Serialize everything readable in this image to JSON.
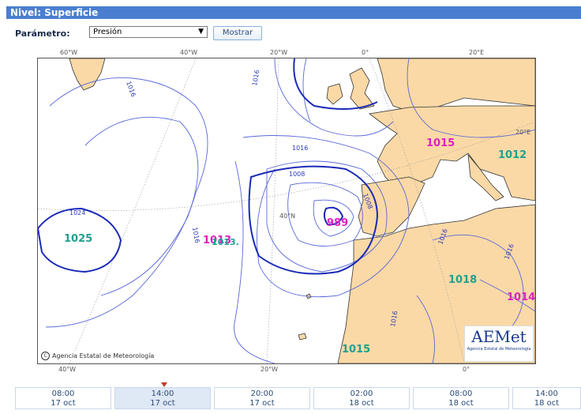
{
  "header": {
    "title": "Nivel: Superficie"
  },
  "controls": {
    "param_label": "Parámetro:",
    "param_value": "Presión",
    "show_label": "Mostrar"
  },
  "map": {
    "top_lon_labels": [
      "60°W",
      "40°W",
      "20°W",
      "0°",
      "20°E"
    ],
    "bottom_lon_labels": [
      "40°W",
      "20°W",
      "0°"
    ],
    "right_lat_label": "20°E",
    "inner_lat_label": "40°N",
    "attribution": "Agencia Estatal de Meteorología",
    "logo_text": "AEMet",
    "logo_sub": "Agencia Estatal de Meteorología",
    "isobar_labels": [
      "1016",
      "1016",
      "1016",
      "1008",
      "1008",
      "1024",
      "1016",
      "1016",
      "1016",
      "1016"
    ],
    "high_values": [
      {
        "value": "1025",
        "color": "#20a090"
      },
      {
        "value": "1018",
        "color": "#20a090"
      },
      {
        "value": "1015",
        "color": "#20a090"
      },
      {
        "value": "1012",
        "color": "#20a090"
      }
    ],
    "low_values": [
      {
        "value": "989",
        "color": "#e020c0"
      },
      {
        "value": "1013",
        "color": "#e020c0"
      },
      {
        "value": "1015",
        "color": "#e020c0"
      },
      {
        "value": "1014",
        "color": "#e020c0"
      }
    ],
    "misc_label": "1013."
  },
  "timeline": [
    {
      "time": "08:00",
      "date": "17 oct"
    },
    {
      "time": "14:00",
      "date": "17 oct"
    },
    {
      "time": "20:00",
      "date": "17 oct"
    },
    {
      "time": "02:00",
      "date": "18 oct"
    },
    {
      "time": "08:00",
      "date": "18 oct"
    },
    {
      "time": "14:00",
      "date": "18 oct"
    }
  ]
}
